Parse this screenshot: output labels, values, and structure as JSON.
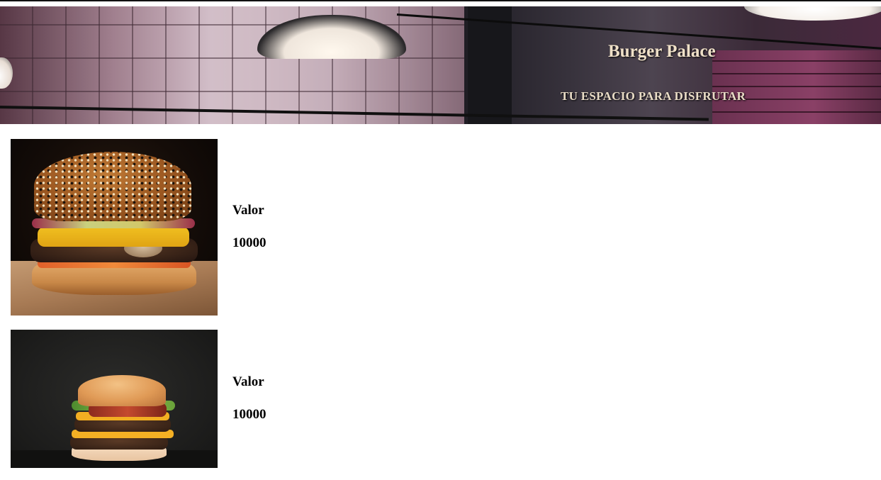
{
  "header": {
    "title": "Burger Palace",
    "subtitle": "TU ESPACIO PARA DISFRUTAR"
  },
  "products": [
    {
      "price_label": "Valor",
      "price": "10000"
    },
    {
      "price_label": "Valor",
      "price": "10000"
    }
  ]
}
